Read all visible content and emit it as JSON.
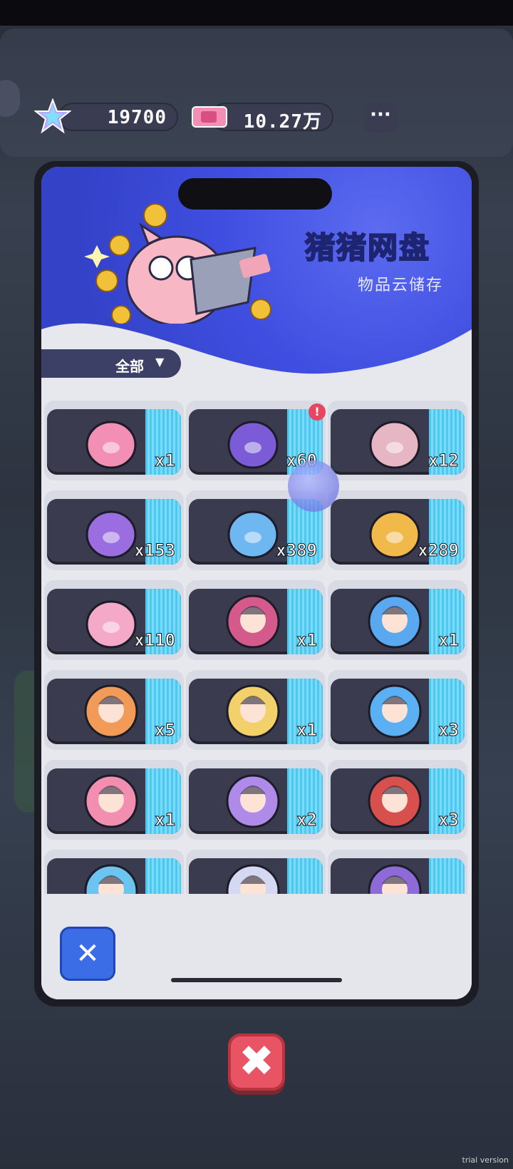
{
  "currency": {
    "stars": {
      "icon": "star-icon",
      "value": "19700"
    },
    "tickets": {
      "icon": "ticket-icon",
      "value": "10.27万"
    },
    "more_label": "···"
  },
  "banner": {
    "title": "猪猪网盘",
    "subtitle": "物品云储存"
  },
  "filter": {
    "label": "全部",
    "caret": "▼"
  },
  "items": [
    {
      "icon": "ticket-item-icon",
      "qty": "x1"
    },
    {
      "icon": "purple-beans-icon",
      "qty": "x60",
      "alert": "!"
    },
    {
      "icon": "drink-cup-icon",
      "qty": "x12"
    },
    {
      "icon": "pig-purple-outfit-icon",
      "qty": "x153"
    },
    {
      "icon": "pig-blue-outfit-icon",
      "qty": "x389"
    },
    {
      "icon": "pig-yellow-outfit-icon",
      "qty": "x289"
    },
    {
      "icon": "pig-pink-outfit-icon",
      "qty": "x110"
    },
    {
      "icon": "avatar-black-hair-icon",
      "qty": "x1"
    },
    {
      "icon": "avatar-blue-hair-icon",
      "qty": "x1"
    },
    {
      "icon": "avatar-pink-orange-icon",
      "qty": "x5"
    },
    {
      "icon": "avatar-blonde-icon",
      "qty": "x1"
    },
    {
      "icon": "avatar-blue-bow-icon",
      "qty": "x3"
    },
    {
      "icon": "avatar-pink-twin-icon",
      "qty": "x1"
    },
    {
      "icon": "avatar-pink-buns-icon",
      "qty": "x2"
    },
    {
      "icon": "avatar-red-hair-icon",
      "qty": "x3"
    },
    {
      "icon": "avatar-cyan-icon",
      "qty": ""
    },
    {
      "icon": "avatar-white-icon",
      "qty": ""
    },
    {
      "icon": "avatar-dark-purple-icon",
      "qty": ""
    }
  ],
  "close_small_label": "✕",
  "close_big_label": "✖",
  "watermark": "trial version",
  "colors": {
    "accent_blue": "#3f4ee0",
    "title_green": "#bff7d6",
    "stripe_cyan": "#4fc6ec",
    "close_red": "#e85463"
  }
}
